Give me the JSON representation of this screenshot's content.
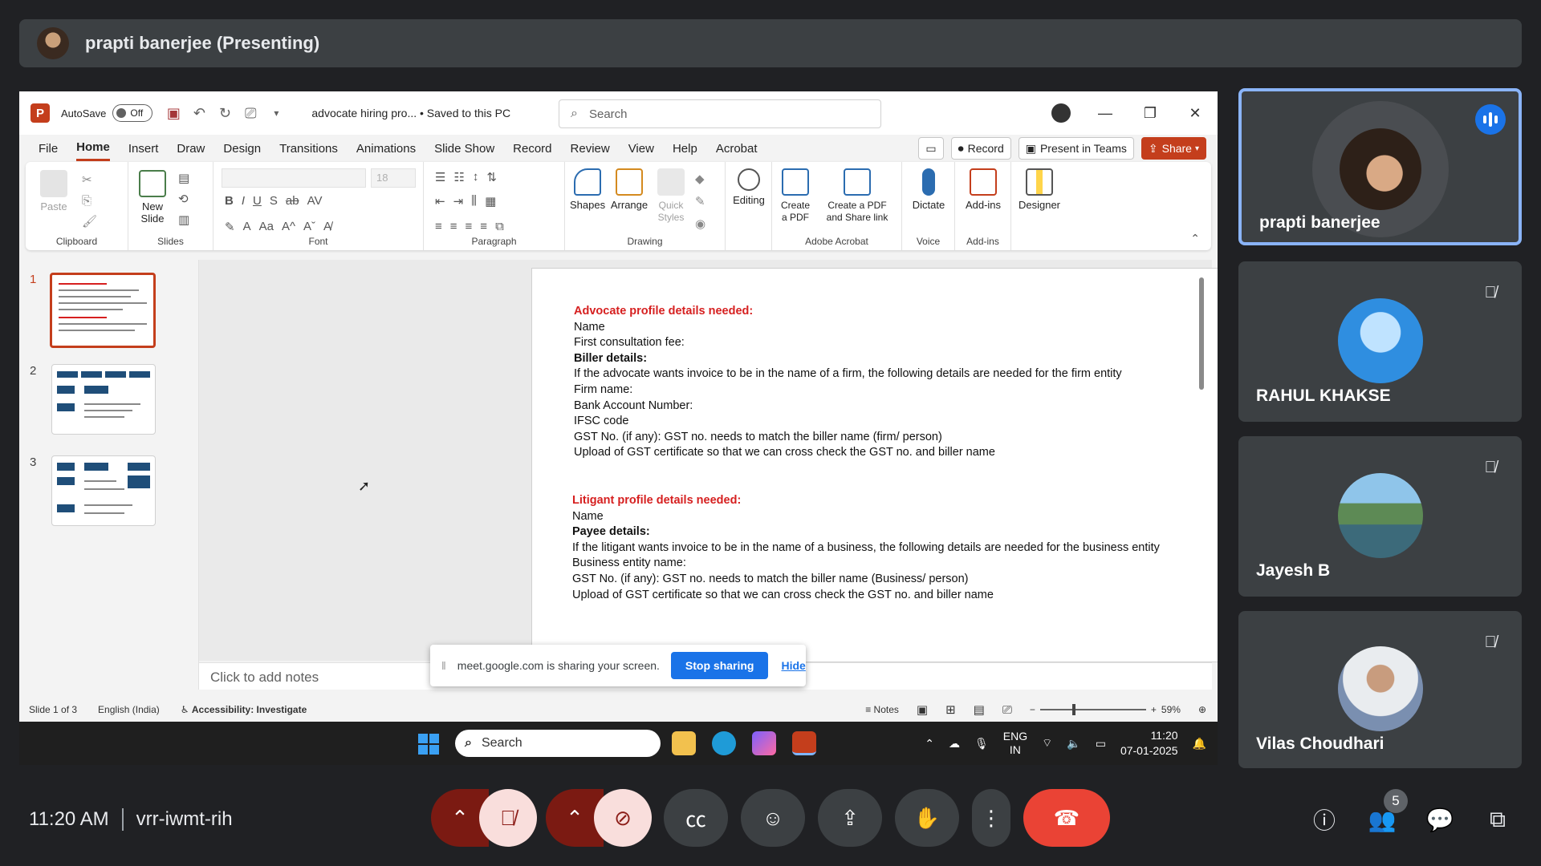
{
  "presenter_banner": {
    "title": "prapti banerjee (Presenting)"
  },
  "ppt": {
    "autosave_label": "AutoSave",
    "autosave_state": "Off",
    "doc_name": "advocate hiring pro...  •  Saved to this PC",
    "search_placeholder": "Search",
    "menu": [
      "File",
      "Home",
      "Insert",
      "Draw",
      "Design",
      "Transitions",
      "Animations",
      "Slide Show",
      "Record",
      "Review",
      "View",
      "Help",
      "Acrobat"
    ],
    "active_menu": "Home",
    "record_label": "Record",
    "present_teams_label": "Present in Teams",
    "share_label": "Share",
    "ribbon": {
      "paste": "Paste",
      "new_slide": "New Slide",
      "clipboard": "Clipboard",
      "slides": "Slides",
      "font_size": "18",
      "font": "Font",
      "paragraph": "Paragraph",
      "shapes": "Shapes",
      "arrange": "Arrange",
      "quick_styles": "Quick Styles",
      "drawing": "Drawing",
      "editing": "Editing",
      "create_pdf": "Create a PDF",
      "create_share": "Create a PDF and Share link",
      "adobe_acrobat": "Adobe Acrobat",
      "dictate": "Dictate",
      "voice": "Voice",
      "addins_btn": "Add-ins",
      "addins_group": "Add-ins",
      "designer": "Designer"
    },
    "thumbs": [
      "1",
      "2",
      "3"
    ],
    "slide": {
      "s1_heading": "Advocate profile details needed:",
      "s1_lines": [
        "Name",
        "First consultation fee:"
      ],
      "s1_bold": "Biller details:",
      "s1_rest": [
        "If the advocate wants invoice to be in the name of a firm, the following details are needed for the firm entity",
        "Firm name:",
        "Bank Account Number:",
        "IFSC code",
        "GST No. (if any): GST no. needs to match the biller name (firm/ person)",
        "Upload of GST certificate so that we can cross check the GST no. and biller name"
      ],
      "s2_heading": "Litigant profile details needed:",
      "s2_name": "Name",
      "s2_bold": "Payee details:",
      "s2_rest": [
        "If the litigant wants invoice to be in the name of a business, the following details are needed for the business entity",
        "Business entity name:",
        "GST No. (if any): GST no. needs to match the biller name (Business/ person)",
        "Upload of GST certificate so that we can cross check the GST no. and biller name"
      ]
    },
    "notes_placeholder": "Click to add notes",
    "share_popup": {
      "text": "meet.google.com is sharing your screen.",
      "stop": "Stop sharing",
      "hide": "Hide"
    },
    "status": {
      "slide": "Slide 1 of 3",
      "lang": "English (India)",
      "accessibility": "Accessibility: Investigate",
      "notes": "Notes",
      "zoom": "59%"
    }
  },
  "taskbar": {
    "search": "Search",
    "lang_top": "ENG",
    "lang_bottom": "IN",
    "time": "11:20",
    "date": "07-01-2025"
  },
  "participants": [
    {
      "name": "prapti banerjee",
      "speaking": true
    },
    {
      "name": "RAHUL KHAKSE",
      "muted": true
    },
    {
      "name": "Jayesh B",
      "muted": true
    },
    {
      "name": "Vilas Choudhari",
      "muted": true
    }
  ],
  "meet": {
    "time": "11:20 AM",
    "code": "vrr-iwmt-rih",
    "people_count": "5"
  }
}
